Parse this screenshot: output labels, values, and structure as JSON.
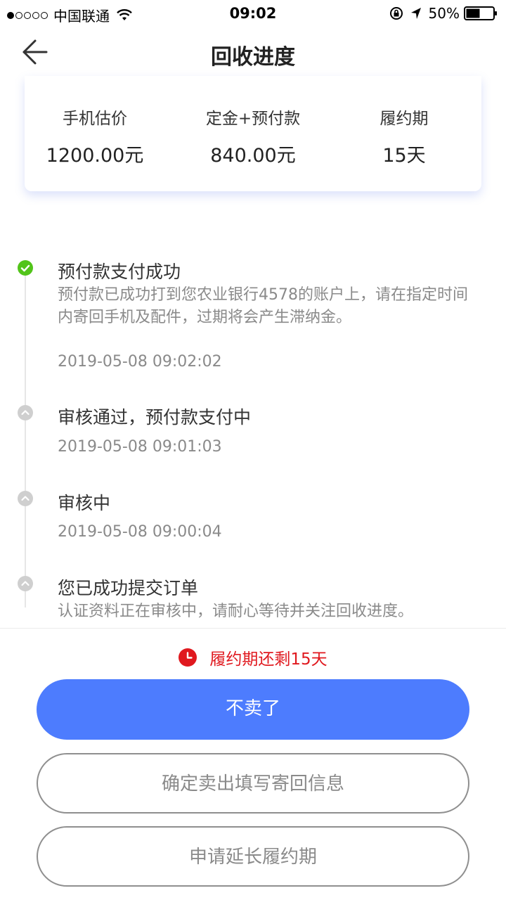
{
  "status_bar": {
    "carrier": "中国联通",
    "time": "09:02",
    "battery": "50%",
    "icons": [
      "signal-dots",
      "wifi-icon",
      "rotation-lock-icon",
      "location-arrow-icon",
      "battery-icon"
    ]
  },
  "nav": {
    "title": "回收进度",
    "back_icon": "arrow-left-icon"
  },
  "summary": {
    "estimate_label": "手机估价",
    "estimate_value": "1200.00元",
    "deposit_label": "定金+预付款",
    "deposit_value": "840.00元",
    "period_label": "履约期",
    "period_value": "15天"
  },
  "timeline": [
    {
      "title": "预付款支付成功",
      "description": "预付款已成功打到您农业银行4578的账户上，请在指定时间内寄回手机及配件，过期将会产生滞纳金。",
      "time": "2019-05-08 09:02:02",
      "status": "done"
    },
    {
      "title": "审核通过，预付款支付中",
      "time": "2019-05-08 09:01:03",
      "status": "past"
    },
    {
      "title": "审核中",
      "time": "2019-05-08 09:00:04",
      "status": "past"
    },
    {
      "title": "您已成功提交订单",
      "description": "认证资料正在审核中，请耐心等待并关注回收进度。",
      "status": "past"
    }
  ],
  "footer": {
    "deadline_text": "履约期还剩15天",
    "cancel_label": "不卖了",
    "confirm_label": "确定卖出填写寄回信息",
    "extend_label": "申请延长履约期"
  },
  "colors": {
    "primary": "#4d7cfe",
    "success": "#52c41a",
    "alert": "#e0191f",
    "muted": "#8a8a8a"
  }
}
